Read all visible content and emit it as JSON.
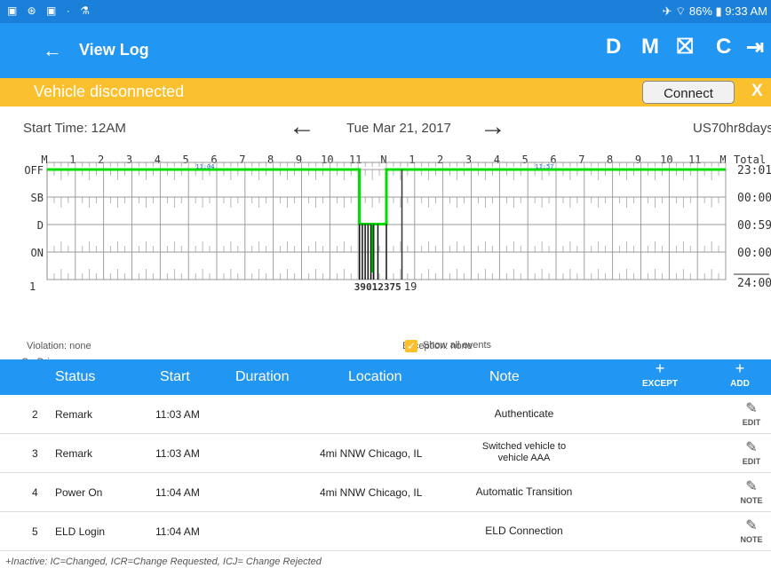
{
  "status_bar": {
    "left_icons": "▣ ⊛ ▣ · ⚗",
    "right_text": "✈ ⌔ 86% ▮ 9:33 AM"
  },
  "appbar": {
    "title": "View Log",
    "actions": {
      "d": "D",
      "m": "M",
      "export": "⛝",
      "refresh": "C",
      "logout": "⇥"
    }
  },
  "banner": {
    "message": "Vehicle disconnected",
    "connect_label": "Connect",
    "close_label": "X"
  },
  "log_header": {
    "start_time": "Start Time: 12AM",
    "date": "Tue Mar 21, 2017",
    "ruleset": "US70hr8days"
  },
  "graph": {
    "hour_labels": [
      "M",
      "1",
      "2",
      "3",
      "4",
      "5",
      "6",
      "7",
      "8",
      "9",
      "10",
      "11",
      "N",
      "1",
      "2",
      "3",
      "4",
      "5",
      "6",
      "7",
      "8",
      "9",
      "10",
      "11",
      "M"
    ],
    "total_header": "Total",
    "rows": [
      {
        "label": "OFF",
        "total": "23:01"
      },
      {
        "label": "SB",
        "total": "00:00"
      },
      {
        "label": "D",
        "total": "00:59"
      },
      {
        "label": "ON",
        "total": "00:00"
      }
    ],
    "grand_total": "24:00",
    "bottom_labels": {
      "left": "1",
      "center": "39012375",
      "right": "19"
    },
    "markers": [
      "11:04",
      "11:57"
    ]
  },
  "info": {
    "violation": "Violation: none",
    "co_drivers": "Co-Drivers: none",
    "exception": "Exception: none",
    "show_all_events": "Show all events"
  },
  "table": {
    "headers": {
      "status": "Status",
      "start": "Start",
      "duration": "Duration",
      "location": "Location",
      "note": "Note",
      "except": "EXCEPT",
      "add": "ADD"
    },
    "rows": [
      {
        "num": "2",
        "status": "Remark",
        "start": "11:03 AM",
        "duration": "",
        "location": "",
        "note": "Authenticate",
        "action": "EDIT"
      },
      {
        "num": "3",
        "status": "Remark",
        "start": "11:03 AM",
        "duration": "",
        "location": "4mi NNW Chicago, IL",
        "note": "Switched vehicle to vehicle AAA",
        "action": "EDIT"
      },
      {
        "num": "4",
        "status": "Power On",
        "start": "11:04 AM",
        "duration": "",
        "location": "4mi NNW Chicago, IL",
        "note": "Automatic Transition",
        "action": "NOTE"
      },
      {
        "num": "5",
        "status": "ELD Login",
        "start": "11:04 AM",
        "duration": "",
        "location": "",
        "note": "ELD Connection",
        "action": "NOTE"
      }
    ],
    "footer": "+Inactive: IC=Changed, ICR=Change Requested, ICJ= Change Rejected"
  },
  "colors": {
    "primary": "#2196f3",
    "banner": "#fbc02d",
    "duty_line": "#00dd00"
  }
}
